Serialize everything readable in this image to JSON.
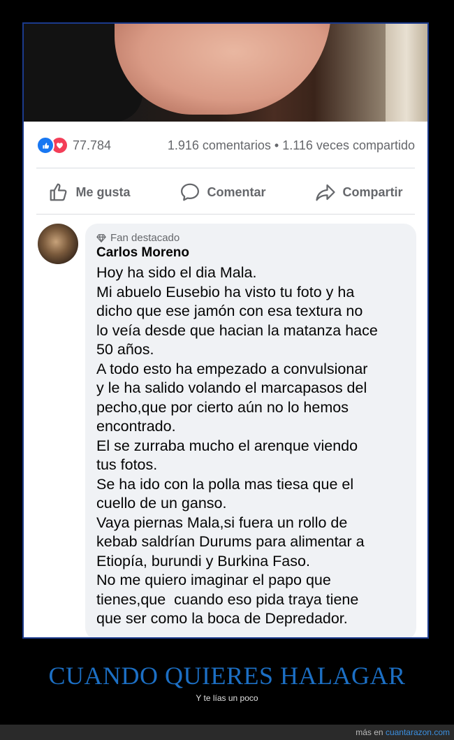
{
  "post": {
    "reaction_count": "77.784",
    "comments_shares": "1.916 comentarios • 1.116 veces compartido"
  },
  "actions": {
    "like": "Me gusta",
    "comment": "Comentar",
    "share": "Compartir"
  },
  "comment": {
    "badge": "Fan destacado",
    "author": "Carlos Moreno",
    "lines": [
      "Hoy ha sido el dia Mala.",
      "Mi abuelo Eusebio ha visto tu foto y ha",
      "dicho que ese jamón con esa textura no",
      "lo veía desde que hacian la matanza hace",
      "50 años.",
      "A todo esto ha empezado a convulsionar",
      "y le ha salido volando el marcapasos del",
      "pecho,que por cierto aún no lo hemos",
      "encontrado.",
      "El se zurraba mucho el arenque viendo",
      "tus fotos.",
      "Se ha ido con la polla mas tiesa que el",
      "cuello de un ganso.",
      "Vaya piernas Mala,si fuera un rollo de",
      "kebab saldrían Durums para alimentar a",
      "Etiopía, burundi y Burkina Faso.",
      "No me quiero imaginar el papo que",
      "tienes,que  cuando eso pida traya tiene",
      "que ser como la boca de Depredador."
    ]
  },
  "meme": {
    "title": "CUANDO QUIERES HALAGAR",
    "subtitle": "Y te lías un poco"
  },
  "footer": {
    "prefix": "más en ",
    "site": "cuantarazon.com"
  },
  "colors": {
    "like_blue": "#1877f2",
    "love_red": "#f33e58",
    "title_blue": "#1c6fc4",
    "bubble_bg": "#f0f2f5"
  },
  "icons": [
    "like-reaction-icon",
    "love-reaction-icon",
    "thumbs-up-icon",
    "comment-icon",
    "share-icon",
    "diamond-icon"
  ]
}
